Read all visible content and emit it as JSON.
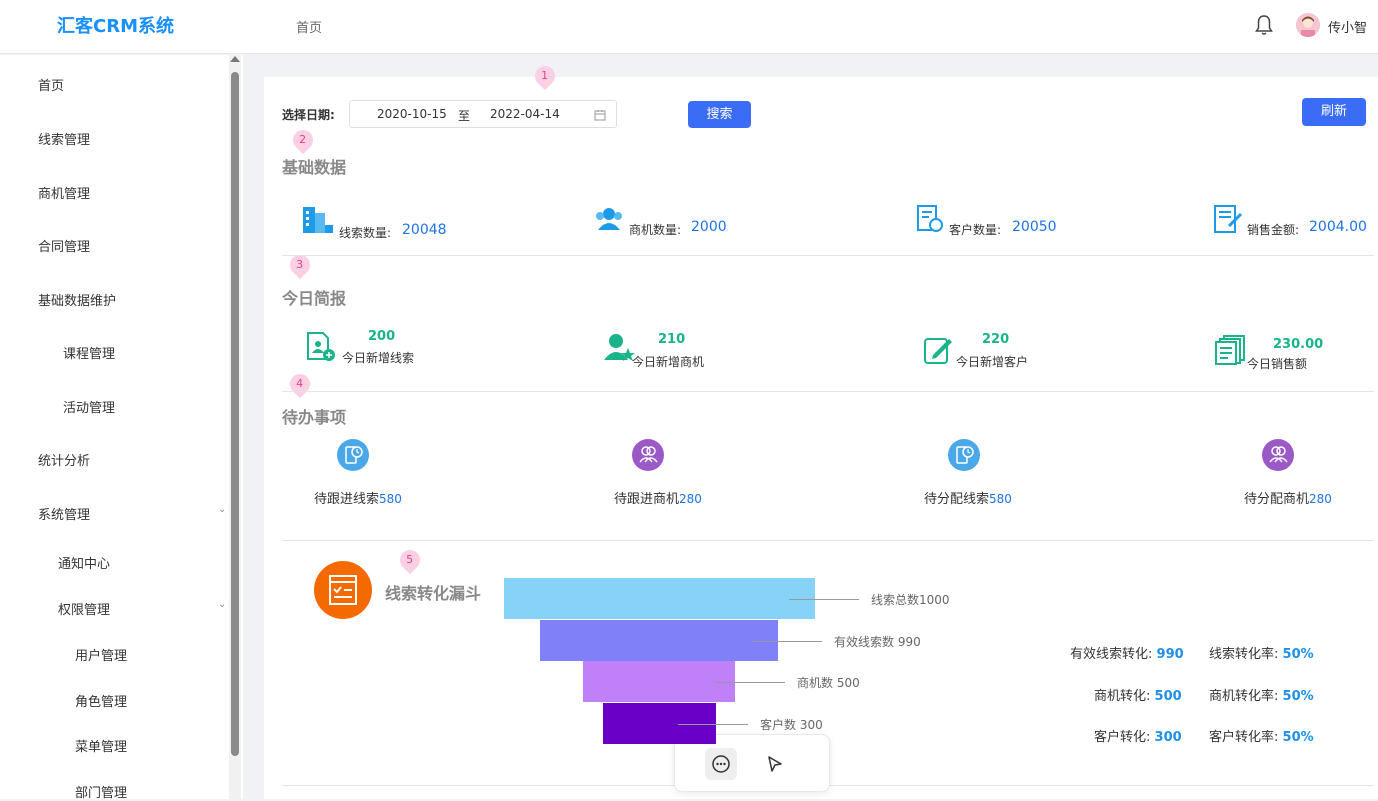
{
  "header": {
    "logo": "汇客CRM系统",
    "breadcrumb": "首页",
    "username": "传小智"
  },
  "sidebar": {
    "items": [
      {
        "label": "首页"
      },
      {
        "label": "线索管理"
      },
      {
        "label": "商机管理"
      },
      {
        "label": "合同管理"
      },
      {
        "label": "基础数据维护"
      },
      {
        "label": "课程管理"
      },
      {
        "label": "活动管理"
      },
      {
        "label": "统计分析"
      },
      {
        "label": "系统管理"
      },
      {
        "label": "通知中心"
      },
      {
        "label": "权限管理"
      },
      {
        "label": "用户管理"
      },
      {
        "label": "角色管理"
      },
      {
        "label": "菜单管理"
      },
      {
        "label": "部门管理"
      }
    ]
  },
  "filter": {
    "label": "选择日期:",
    "start": "2020-10-15",
    "sep": "至",
    "end": "2022-04-14",
    "search": "搜索",
    "refresh": "刷新"
  },
  "pins": [
    "1",
    "2",
    "3",
    "4",
    "5"
  ],
  "basic": {
    "title": "基础数据",
    "stats": [
      {
        "label": "线索数量:",
        "value": "20048"
      },
      {
        "label": "商机数量:",
        "value": "2000"
      },
      {
        "label": "客户数量:",
        "value": "20050"
      },
      {
        "label": "销售金额:",
        "value": "2004.00"
      }
    ]
  },
  "today": {
    "title": "今日简报",
    "stats": [
      {
        "value": "200",
        "label": "今日新增线索"
      },
      {
        "value": "210",
        "label": "今日新增商机"
      },
      {
        "value": "220",
        "label": "今日新增客户"
      },
      {
        "value": "230.00",
        "label": "今日销售额"
      }
    ]
  },
  "todo": {
    "title": "待办事项",
    "items": [
      {
        "label": "待跟进线索",
        "count": "580"
      },
      {
        "label": "待跟进商机",
        "count": "280"
      },
      {
        "label": "待分配线索",
        "count": "580"
      },
      {
        "label": "待分配商机",
        "count": "280"
      }
    ]
  },
  "funnel": {
    "title": "线索转化漏斗",
    "colors": [
      "#87d3f8",
      "#8080f8",
      "#c080f8",
      "#6a00c8"
    ],
    "levels": [
      {
        "label": "线索总数1000",
        "value": 1000
      },
      {
        "label": "有效线索数 990",
        "value": 990
      },
      {
        "label": "商机数 500",
        "value": 500
      },
      {
        "label": "客户数 300",
        "value": 300
      }
    ],
    "conversions": [
      {
        "label": "有效线索转化:",
        "value": "990",
        "rate_label": "线索转化率:",
        "rate": "50%"
      },
      {
        "label": "商机转化:",
        "value": "500",
        "rate_label": "商机转化率:",
        "rate": "50%"
      },
      {
        "label": "客户转化:",
        "value": "300",
        "rate_label": "客户转化率:",
        "rate": "50%"
      }
    ]
  }
}
